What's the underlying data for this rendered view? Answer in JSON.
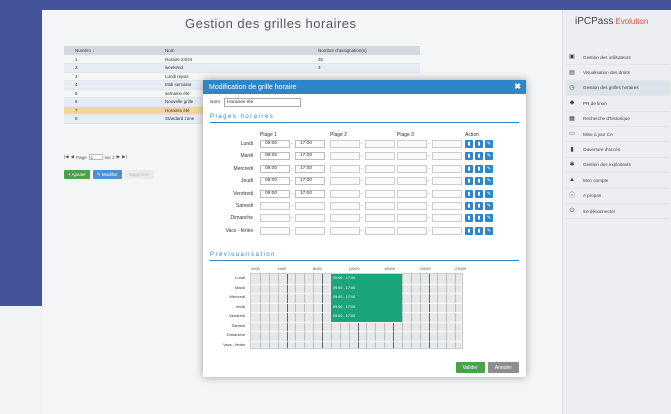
{
  "app": {
    "title": "Gestion des grilles horaires",
    "brand": "iPCPass",
    "brand_suffix": "Evolution"
  },
  "sidebar": {
    "items": [
      {
        "label": "Gestion des utilisateurs",
        "icon": "users-icon"
      },
      {
        "label": "Visualisation des droits",
        "icon": "rights-icon"
      },
      {
        "label": "Gestion des grilles horaires",
        "icon": "clock-icon",
        "active": true
      },
      {
        "label": "PR de linon",
        "icon": "pr-icon"
      },
      {
        "label": "Recherche d'historique",
        "icon": "history-icon"
      },
      {
        "label": "Mise à jour CA",
        "icon": "update-icon"
      },
      {
        "label": "Ouverture d'accès",
        "icon": "door-icon"
      },
      {
        "label": "Gestion des exploitants",
        "icon": "operators-icon"
      },
      {
        "label": "Mon compte",
        "icon": "account-icon"
      },
      {
        "label": "A propos",
        "icon": "info-icon"
      },
      {
        "label": "Se déconnecter",
        "icon": "logout-icon"
      }
    ]
  },
  "grid": {
    "columns": [
      "Numéro ↓",
      "Nom",
      "Nombre d'assignation(s)"
    ],
    "rows": [
      {
        "num": "1",
        "name": "Horaire 24/24",
        "count": "30"
      },
      {
        "num": "2",
        "name": "weekend",
        "count": "3"
      },
      {
        "num": "3",
        "name": "Lundi repos",
        "count": ""
      },
      {
        "num": "4",
        "name": "Midi semaine",
        "count": ""
      },
      {
        "num": "5",
        "name": "semaine été",
        "count": ""
      },
      {
        "num": "6",
        "name": "Nouvelle grille",
        "count": ""
      },
      {
        "num": "7",
        "name": "Horaires été",
        "count": ""
      },
      {
        "num": "8",
        "name": "Standard zone",
        "count": ""
      }
    ],
    "pager": {
      "first": "|◀",
      "prev": "◀",
      "page_label": "Page",
      "page_value": "1",
      "of": "sur 1",
      "next": "▶",
      "last": "▶|"
    },
    "buttons": {
      "add": "+ Ajouter",
      "edit": "✎ Modifier",
      "delete": "Supprimer"
    }
  },
  "modal": {
    "title": "Modification de grille horaire",
    "close": "✖",
    "name_label": "Nom",
    "name_value": "Horaires été",
    "section_ranges": "Plages horaires",
    "section_preview": "Prévisualisation",
    "headers": [
      "Plage 1",
      "Plage 2",
      "Plage 3",
      "Action"
    ],
    "days": [
      {
        "name": "Lundi",
        "p1": [
          "09:00",
          "17:00"
        ]
      },
      {
        "name": "Mardi",
        "p1": [
          "09:00",
          "17:00"
        ]
      },
      {
        "name": "Mercredi",
        "p1": [
          "09:00",
          "17:00"
        ]
      },
      {
        "name": "Jeudi",
        "p1": [
          "09:00",
          "17:00"
        ]
      },
      {
        "name": "Vendredi",
        "p1": [
          "09:00",
          "17:00"
        ]
      },
      {
        "name": "Samedi",
        "p1": [
          "",
          ""
        ]
      },
      {
        "name": "Dimanche",
        "p1": [
          "",
          ""
        ]
      },
      {
        "name": "Vacs - fériés",
        "p1": [
          "",
          ""
        ]
      }
    ],
    "hour_labels": [
      "1h00",
      "4h00",
      "8h00",
      "12h00",
      "16h00",
      "20h00",
      "23h59"
    ],
    "preview_bars": [
      {
        "day": "Lundi",
        "label": "09:00 - 17:00"
      },
      {
        "day": "Mardi",
        "label": "09:00 - 17:00"
      },
      {
        "day": "Mercredi",
        "label": "09:00 - 17:00"
      },
      {
        "day": "Jeudi",
        "label": "09:00 - 17:00"
      },
      {
        "day": "Vendredi",
        "label": "09:00 - 17:00"
      }
    ],
    "preview_days": [
      "Lundi",
      "Mardi",
      "Mercredi",
      "Jeudi",
      "Vendredi",
      "Samedi",
      "Dimanche",
      "Vacs - fériés"
    ],
    "validate": "Valider",
    "cancel": "Annuler"
  },
  "colors": {
    "accent": "#2e86c9",
    "green": "#46a447",
    "bar": "#1ca47b",
    "selected_row": "#f5d896"
  }
}
